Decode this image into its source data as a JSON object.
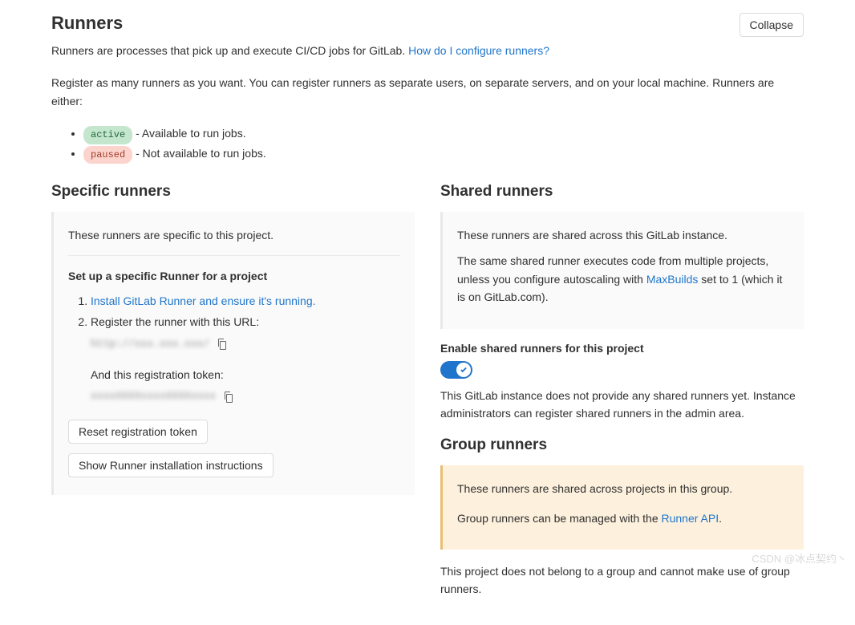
{
  "header": {
    "title": "Runners",
    "collapse_label": "Collapse"
  },
  "intro": {
    "line1_a": "Runners are processes that pick up and execute CI/CD jobs for GitLab. ",
    "line1_link": "How do I configure runners?",
    "line2": "Register as many runners as you want. You can register runners as separate users, on separate servers, and on your local machine. Runners are either:"
  },
  "statuses": {
    "active_label": "active",
    "active_desc": " - Available to run jobs.",
    "paused_label": "paused",
    "paused_desc": " - Not available to run jobs."
  },
  "specific": {
    "title": "Specific runners",
    "card_text": "These runners are specific to this project.",
    "setup_heading": "Set up a specific Runner for a project",
    "step1_link": "Install GitLab Runner and ensure it's running.",
    "step2_text": "Register the runner with this URL:",
    "url_value": "http://xxx.xxx.xxx/",
    "token_label": "And this registration token:",
    "token_value": "xxxxXXXXxxxxXXXXxxxx",
    "reset_button": "Reset registration token",
    "show_button": "Show Runner installation instructions"
  },
  "shared": {
    "title": "Shared runners",
    "card_p1": "These runners are shared across this GitLab instance.",
    "card_p2a": "The same shared runner executes code from multiple projects, unless you configure autoscaling with ",
    "card_p2_link": "MaxBuilds",
    "card_p2b": " set to 1 (which it is on GitLab.com).",
    "toggle_label": "Enable shared runners for this project",
    "toggle_on": true,
    "info_text": "This GitLab instance does not provide any shared runners yet. Instance administrators can register shared runners in the admin area."
  },
  "group": {
    "title": "Group runners",
    "card_p1": "These runners are shared across projects in this group.",
    "card_p2a": "Group runners can be managed with the ",
    "card_p2_link": "Runner API",
    "card_p2b": ".",
    "info_text": "This project does not belong to a group and cannot make use of group runners."
  },
  "watermark": "CSDN @冰点契约丶"
}
